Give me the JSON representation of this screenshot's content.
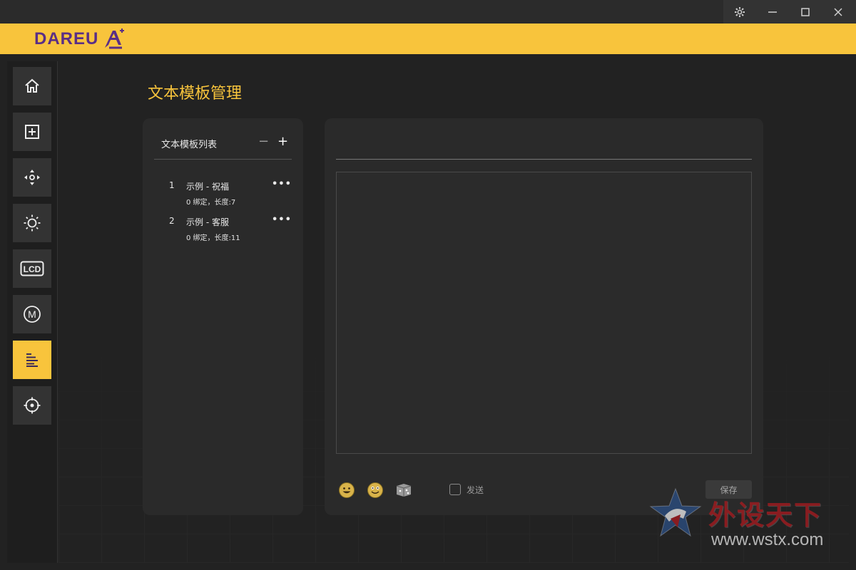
{
  "window": {
    "controls": [
      "settings",
      "minimize",
      "maximize",
      "close"
    ]
  },
  "brand": {
    "logo_text": "DAREU",
    "accent_color": "#f8c43c",
    "logo_color": "#5a2e86"
  },
  "sidebar": {
    "items": [
      {
        "icon": "home-icon",
        "active": false
      },
      {
        "icon": "add-box-icon",
        "active": false
      },
      {
        "icon": "move-arrows-icon",
        "active": false
      },
      {
        "icon": "brightness-icon",
        "active": false
      },
      {
        "icon": "lcd-icon",
        "label": "LCD",
        "active": false
      },
      {
        "icon": "macro-icon",
        "label": "M",
        "active": false
      },
      {
        "icon": "text-template-icon",
        "active": true
      },
      {
        "icon": "crosshair-icon",
        "active": false
      }
    ]
  },
  "page": {
    "title": "文本模板管理"
  },
  "template_list": {
    "title": "文本模板列表",
    "remove_label": "−",
    "add_label": "+",
    "items": [
      {
        "num": "1",
        "name": "示例 - 祝福",
        "meta": "0 绑定，长度:7",
        "more": "•••"
      },
      {
        "num": "2",
        "name": "示例 - 客服",
        "meta": "0 绑定，长度:11",
        "more": "•••"
      }
    ]
  },
  "editor": {
    "name_value": "",
    "content_value": "",
    "emojis": [
      "grin-emoji-icon",
      "smile-emoji-icon",
      "dice-icon"
    ],
    "send_label": "发送",
    "send_checked": false,
    "save_label": "保存"
  },
  "watermark": {
    "brand": "外设天下",
    "url": "www.wstx.com"
  }
}
